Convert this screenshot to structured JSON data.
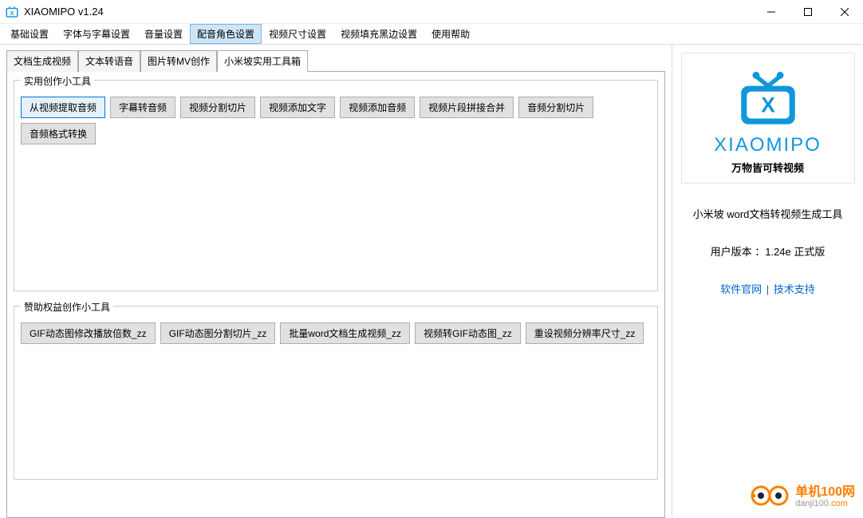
{
  "window": {
    "title": "XIAOMIPO v1.24"
  },
  "menubar": {
    "items": [
      {
        "label": "基础设置",
        "active": false
      },
      {
        "label": "字体与字幕设置",
        "active": false
      },
      {
        "label": "音量设置",
        "active": false
      },
      {
        "label": "配音角色设置",
        "active": true
      },
      {
        "label": "视频尺寸设置",
        "active": false
      },
      {
        "label": "视频填充黑边设置",
        "active": false
      },
      {
        "label": "使用帮助",
        "active": false
      }
    ]
  },
  "tabs": {
    "items": [
      {
        "label": "文档生成视频",
        "active": false
      },
      {
        "label": "文本转语音",
        "active": false
      },
      {
        "label": "图片转MV创作",
        "active": false
      },
      {
        "label": "小米坡实用工具箱",
        "active": true
      }
    ]
  },
  "group1": {
    "title": "实用创作小工具",
    "buttons": [
      {
        "label": "从视频提取音频",
        "selected": true
      },
      {
        "label": "字幕转音频",
        "selected": false
      },
      {
        "label": "视频分割切片",
        "selected": false
      },
      {
        "label": "视频添加文字",
        "selected": false
      },
      {
        "label": "视频添加音频",
        "selected": false
      },
      {
        "label": "视频片段拼接合并",
        "selected": false
      },
      {
        "label": "音频分割切片",
        "selected": false
      },
      {
        "label": "音频格式转换",
        "selected": false
      }
    ]
  },
  "group2": {
    "title": "赞助权益创作小工具",
    "buttons": [
      {
        "label": "GIF动态图修改播放倍数_zz"
      },
      {
        "label": "GIF动态图分割切片_zz"
      },
      {
        "label": "批量word文档生成视频_zz"
      },
      {
        "label": "视频转GIF动态图_zz"
      },
      {
        "label": "重设视频分辨率尺寸_zz"
      }
    ]
  },
  "sidebar": {
    "logo_text": "XIAOMIPO",
    "logo_sub": "万物皆可转视频",
    "desc": "小米坡 word文档转视频生成工具",
    "version_line": "用户版本 ：1.24e 正式版",
    "link1": "软件官网",
    "link_sep": " | ",
    "link2": "技术支持"
  },
  "watermark": {
    "top": "单机100网",
    "domain_pre": "danji100",
    "domain_suf": ".com"
  }
}
